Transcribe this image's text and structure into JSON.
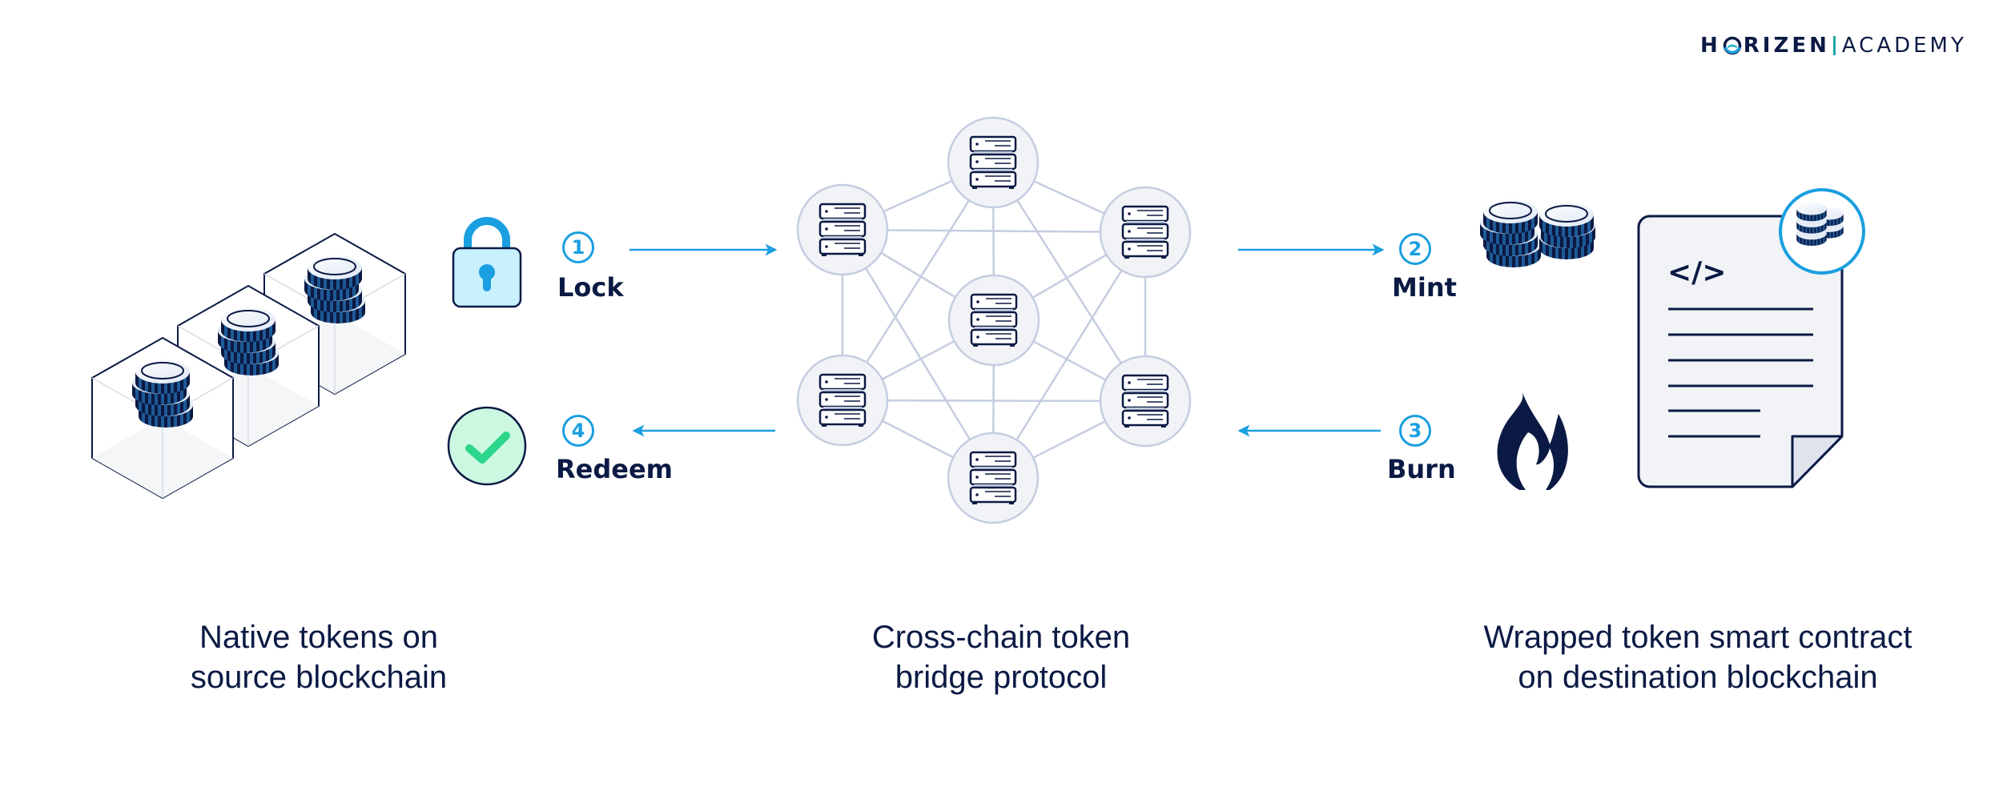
{
  "brand": {
    "name_part1": "H",
    "name_part2": "RIZEN",
    "name_part3": "ACADEMY",
    "icon": "horizen-o-logo-icon"
  },
  "colors": {
    "navy": "#0b1a44",
    "accent_blue": "#1a9fe0",
    "node_fill": "#f1f3f6",
    "node_stroke": "#c5cde0",
    "check_green": "#2bd58a",
    "check_bg": "#ccf8e2",
    "lock_bg": "#c9f0fd"
  },
  "sections": {
    "source": {
      "caption_line1": "Native tokens on",
      "caption_line2": "source blockchain",
      "icon": "coins-in-blocks-icon"
    },
    "bridge": {
      "caption_line1": "Cross-chain token",
      "caption_line2": "bridge protocol",
      "icon": "server-network-icon",
      "node_count": 7
    },
    "destination": {
      "caption_line1": "Wrapped token smart contract",
      "caption_line2": "on destination blockchain",
      "icon": "smart-contract-document-icon",
      "code_symbol": "</>"
    }
  },
  "steps": [
    {
      "number": "1",
      "label": "Lock",
      "icon": "padlock-icon",
      "direction": "right"
    },
    {
      "number": "2",
      "label": "Mint",
      "icon": "coin-stacks-icon",
      "direction": "right"
    },
    {
      "number": "3",
      "label": "Burn",
      "icon": "flame-icon",
      "direction": "left"
    },
    {
      "number": "4",
      "label": "Redeem",
      "icon": "checkmark-icon",
      "direction": "left"
    }
  ]
}
